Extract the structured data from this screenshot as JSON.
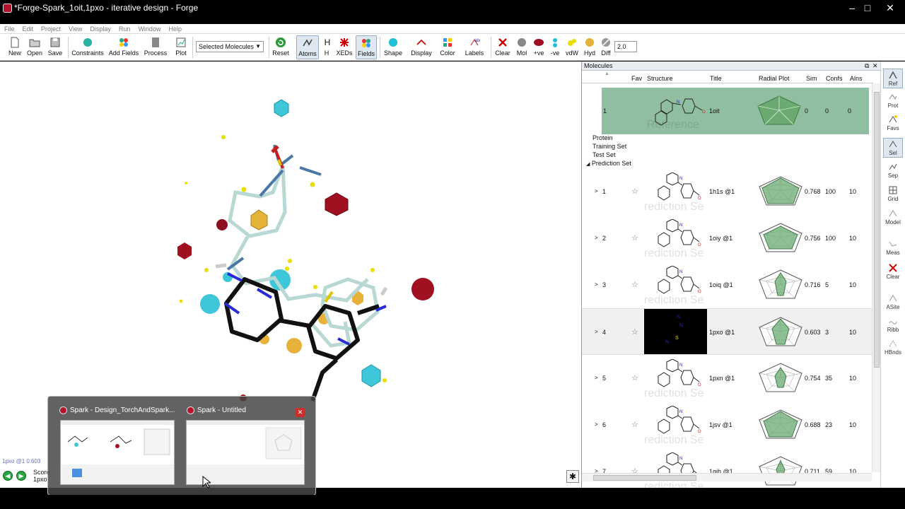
{
  "window": {
    "title": "*Forge-Spark_1oit,1pxo - iterative design - Forge",
    "controls": [
      "–",
      "□",
      "✕"
    ]
  },
  "menu": [
    "File",
    "Edit",
    "Project",
    "View",
    "Display",
    "Run",
    "Window",
    "Help"
  ],
  "toolbar": {
    "new": "New",
    "open": "Open",
    "save": "Save",
    "constraints": "Constraints",
    "add_fields": "Add Fields",
    "process": "Process",
    "plot": "Plot",
    "selector_value": "Selected Molecules",
    "reset": "Reset",
    "atoms": "Atoms",
    "h": "H",
    "xeds": "XEDs",
    "fields": "Fields",
    "shape": "Shape",
    "display": "Display",
    "color": "Color",
    "labels": "Labels",
    "clear": "Clear",
    "mol": "Mol",
    "pos": "+ve",
    "neg": "-ve",
    "vdw": "vdW",
    "hyd": "Hyd",
    "diff": "Diff",
    "spin_value": "2.0"
  },
  "viewer": {
    "status": "1pxo @1 0.603",
    "score_label": "Score",
    "score_mol": "1pxo"
  },
  "panel": {
    "title": "Molecules",
    "columns": {
      "fav": "Fav",
      "structure": "Structure",
      "title": "Title",
      "radial": "Radial Plot",
      "sim": "Sim",
      "confs": "Confs",
      "alns": "Alns"
    },
    "reference": {
      "num": "1",
      "title": "1oit",
      "sim": "0",
      "confs": "0",
      "alns": "0",
      "ghost": "Reference"
    },
    "groups": [
      "Protein",
      "Training Set",
      "Test Set",
      "Prediction Set"
    ],
    "ghost": "rediction Se",
    "rows": [
      {
        "num": "1",
        "title": "1h1s @1",
        "sim": "0.768",
        "confs": "100",
        "alns": "10"
      },
      {
        "num": "2",
        "title": "1oiy @1",
        "sim": "0.756",
        "confs": "100",
        "alns": "10"
      },
      {
        "num": "3",
        "title": "1oiq @1",
        "sim": "0.716",
        "confs": "5",
        "alns": "10"
      },
      {
        "num": "4",
        "title": "1pxo @1",
        "sim": "0.603",
        "confs": "3",
        "alns": "10"
      },
      {
        "num": "5",
        "title": "1pxn @1",
        "sim": "0.754",
        "confs": "35",
        "alns": "10"
      },
      {
        "num": "6",
        "title": "1jsv @1",
        "sim": "0.688",
        "confs": "23",
        "alns": "10"
      },
      {
        "num": "7",
        "title": "1gih @1",
        "sim": "0.711",
        "confs": "59",
        "alns": "10"
      }
    ],
    "structure_dark_labels": [
      "N",
      "S"
    ]
  },
  "strip": [
    "Ref",
    "Prot",
    "Favs",
    "Sel",
    "Sep",
    "Grid",
    "Model",
    "Meas",
    "Clear",
    "ASite",
    "Ribb",
    "HBnds"
  ],
  "taskbar": {
    "thumb1_title": "Spark - Design_TorchAndSpark...",
    "thumb2_title": "Spark - Untitled",
    "close": "✕"
  }
}
